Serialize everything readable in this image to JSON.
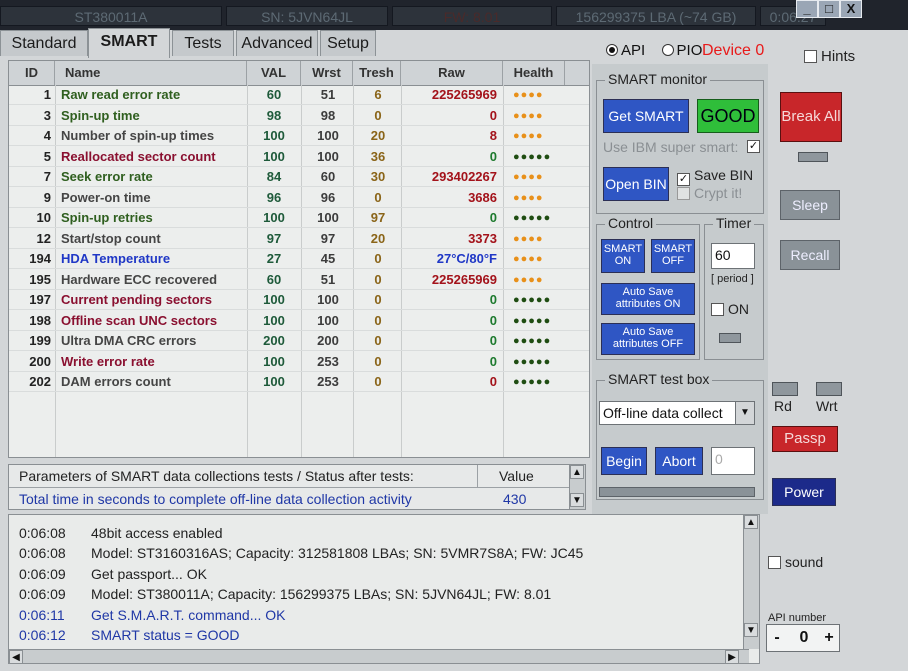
{
  "titlebar": {
    "model": "ST380011A",
    "serial": "SN: 5JVN64JL",
    "fw": "FW: 8.01",
    "lba": "156299375 LBA (~74 GB)",
    "time": "0:06:27",
    "min_label": "_",
    "max_label": "□",
    "close_label": "X"
  },
  "tabs": [
    "Standard",
    "SMART",
    "Tests",
    "Advanced",
    "Setup"
  ],
  "mode": {
    "api": "API",
    "pio": "PIO",
    "device": "Device 0",
    "hints": "Hints"
  },
  "smart_table": {
    "headers": [
      "ID",
      "Name",
      "VAL",
      "Wrst",
      "Tresh",
      "Raw",
      "Health"
    ],
    "rows": [
      {
        "id": "1",
        "name": "Raw read error rate",
        "val": "60",
        "wrst": "51",
        "tresh": "6",
        "raw": "225265969",
        "health": "●●●●",
        "raw_color": "#a3121a",
        "name_color": "#2f5f1f",
        "health_color": "#e8901a"
      },
      {
        "id": "3",
        "name": "Spin-up time",
        "val": "98",
        "wrst": "98",
        "tresh": "0",
        "raw": "0",
        "health": "●●●●",
        "raw_color": "#a3121a",
        "name_color": "#2f5f1f",
        "health_color": "#e8901a"
      },
      {
        "id": "4",
        "name": "Number of spin-up times",
        "val": "100",
        "wrst": "100",
        "tresh": "20",
        "raw": "8",
        "health": "●●●●",
        "raw_color": "#a3121a",
        "name_color": "#454545",
        "health_color": "#e8901a"
      },
      {
        "id": "5",
        "name": "Reallocated sector count",
        "val": "100",
        "wrst": "100",
        "tresh": "36",
        "raw": "0",
        "health": "●●●●●",
        "raw_color": "#1d7a2e",
        "name_color": "#8a1030",
        "health_color": "#1f4d12"
      },
      {
        "id": "7",
        "name": "Seek error rate",
        "val": "84",
        "wrst": "60",
        "tresh": "30",
        "raw": "293402267",
        "health": "●●●●",
        "raw_color": "#a3121a",
        "name_color": "#2f5f1f",
        "health_color": "#e8901a"
      },
      {
        "id": "9",
        "name": "Power-on time",
        "val": "96",
        "wrst": "96",
        "tresh": "0",
        "raw": "3686",
        "health": "●●●●",
        "raw_color": "#a3121a",
        "name_color": "#454545",
        "health_color": "#e8901a"
      },
      {
        "id": "10",
        "name": "Spin-up retries",
        "val": "100",
        "wrst": "100",
        "tresh": "97",
        "raw": "0",
        "health": "●●●●●",
        "raw_color": "#1d7a2e",
        "name_color": "#2f5f1f",
        "health_color": "#1f4d12"
      },
      {
        "id": "12",
        "name": "Start/stop count",
        "val": "97",
        "wrst": "97",
        "tresh": "20",
        "raw": "3373",
        "health": "●●●●",
        "raw_color": "#a3121a",
        "name_color": "#454545",
        "health_color": "#e8901a"
      },
      {
        "id": "194",
        "name": "HDA Temperature",
        "val": "27",
        "wrst": "45",
        "tresh": "0",
        "raw": "27°C/80°F",
        "health": "●●●●",
        "raw_color": "#1f37c6",
        "name_color": "#1f37c6",
        "health_color": "#e8901a"
      },
      {
        "id": "195",
        "name": "Hardware ECC recovered",
        "val": "60",
        "wrst": "51",
        "tresh": "0",
        "raw": "225265969",
        "health": "●●●●",
        "raw_color": "#a3121a",
        "name_color": "#454545",
        "health_color": "#e8901a"
      },
      {
        "id": "197",
        "name": "Current pending sectors",
        "val": "100",
        "wrst": "100",
        "tresh": "0",
        "raw": "0",
        "health": "●●●●●",
        "raw_color": "#1d7a2e",
        "name_color": "#8a1030",
        "health_color": "#1f4d12"
      },
      {
        "id": "198",
        "name": "Offline scan UNC sectors",
        "val": "100",
        "wrst": "100",
        "tresh": "0",
        "raw": "0",
        "health": "●●●●●",
        "raw_color": "#1d7a2e",
        "name_color": "#8a1030",
        "health_color": "#1f4d12"
      },
      {
        "id": "199",
        "name": "Ultra DMA CRC errors",
        "val": "200",
        "wrst": "200",
        "tresh": "0",
        "raw": "0",
        "health": "●●●●●",
        "raw_color": "#1d7a2e",
        "name_color": "#454545",
        "health_color": "#1f4d12"
      },
      {
        "id": "200",
        "name": "Write error rate",
        "val": "100",
        "wrst": "253",
        "tresh": "0",
        "raw": "0",
        "health": "●●●●●",
        "raw_color": "#1d7a2e",
        "name_color": "#8a1030",
        "health_color": "#1f4d12"
      },
      {
        "id": "202",
        "name": "DAM errors count",
        "val": "100",
        "wrst": "253",
        "tresh": "0",
        "raw": "0",
        "health": "●●●●●",
        "raw_color": "#a3121a",
        "name_color": "#454545",
        "health_color": "#1f4d12"
      }
    ]
  },
  "params": {
    "header": "Parameters of SMART data collections tests / Status after tests:",
    "value_header": "Value",
    "row_label": "Total time in seconds to complete off-line data collection activity",
    "row_value": "430"
  },
  "log": [
    {
      "time": "0:06:08",
      "text": "48bit access enabled",
      "color": "#222222"
    },
    {
      "time": "0:06:08",
      "text": "Model: ST3160316AS; Capacity: 312581808 LBAs; SN: 5VMR7S8A; FW: JC45",
      "color": "#222222"
    },
    {
      "time": "0:06:09",
      "text": "Get passport... OK",
      "color": "#222222"
    },
    {
      "time": "0:06:09",
      "text": "Model: ST380011A; Capacity: 156299375 LBAs; SN: 5JVN64JL; FW: 8.01",
      "color": "#222222"
    },
    {
      "time": "0:06:11",
      "text": "Get S.M.A.R.T. command... OK",
      "color": "#1f37a6"
    },
    {
      "time": "0:06:12",
      "text": "SMART status = GOOD",
      "color": "#1f37a6"
    }
  ],
  "smart_monitor": {
    "title": "SMART monitor",
    "get_smart": "Get SMART",
    "status": "GOOD",
    "ibm_label": "Use IBM super smart:",
    "open_bin": "Open BIN",
    "save_bin": "Save BIN",
    "crypt": "Crypt it!"
  },
  "control": {
    "title": "Control",
    "smart_on": "SMART ON",
    "smart_off": "SMART OFF",
    "auto_on": "Auto Save attributes ON",
    "auto_off": "Auto Save attributes OFF"
  },
  "timer": {
    "title": "Timer",
    "value": "60",
    "period": "[ period ]",
    "on": "ON"
  },
  "test_box": {
    "title": "SMART test box",
    "selected": "Off-line data collect",
    "begin": "Begin",
    "abort": "Abort",
    "counter": "0"
  },
  "side": {
    "break_all": "Break All",
    "sleep": "Sleep",
    "recall": "Recall",
    "rd": "Rd",
    "wrt": "Wrt",
    "passp": "Passp",
    "power": "Power",
    "sound": "sound",
    "api_number_label": "API number",
    "api_number": "0",
    "minus": "-",
    "plus": "+"
  }
}
